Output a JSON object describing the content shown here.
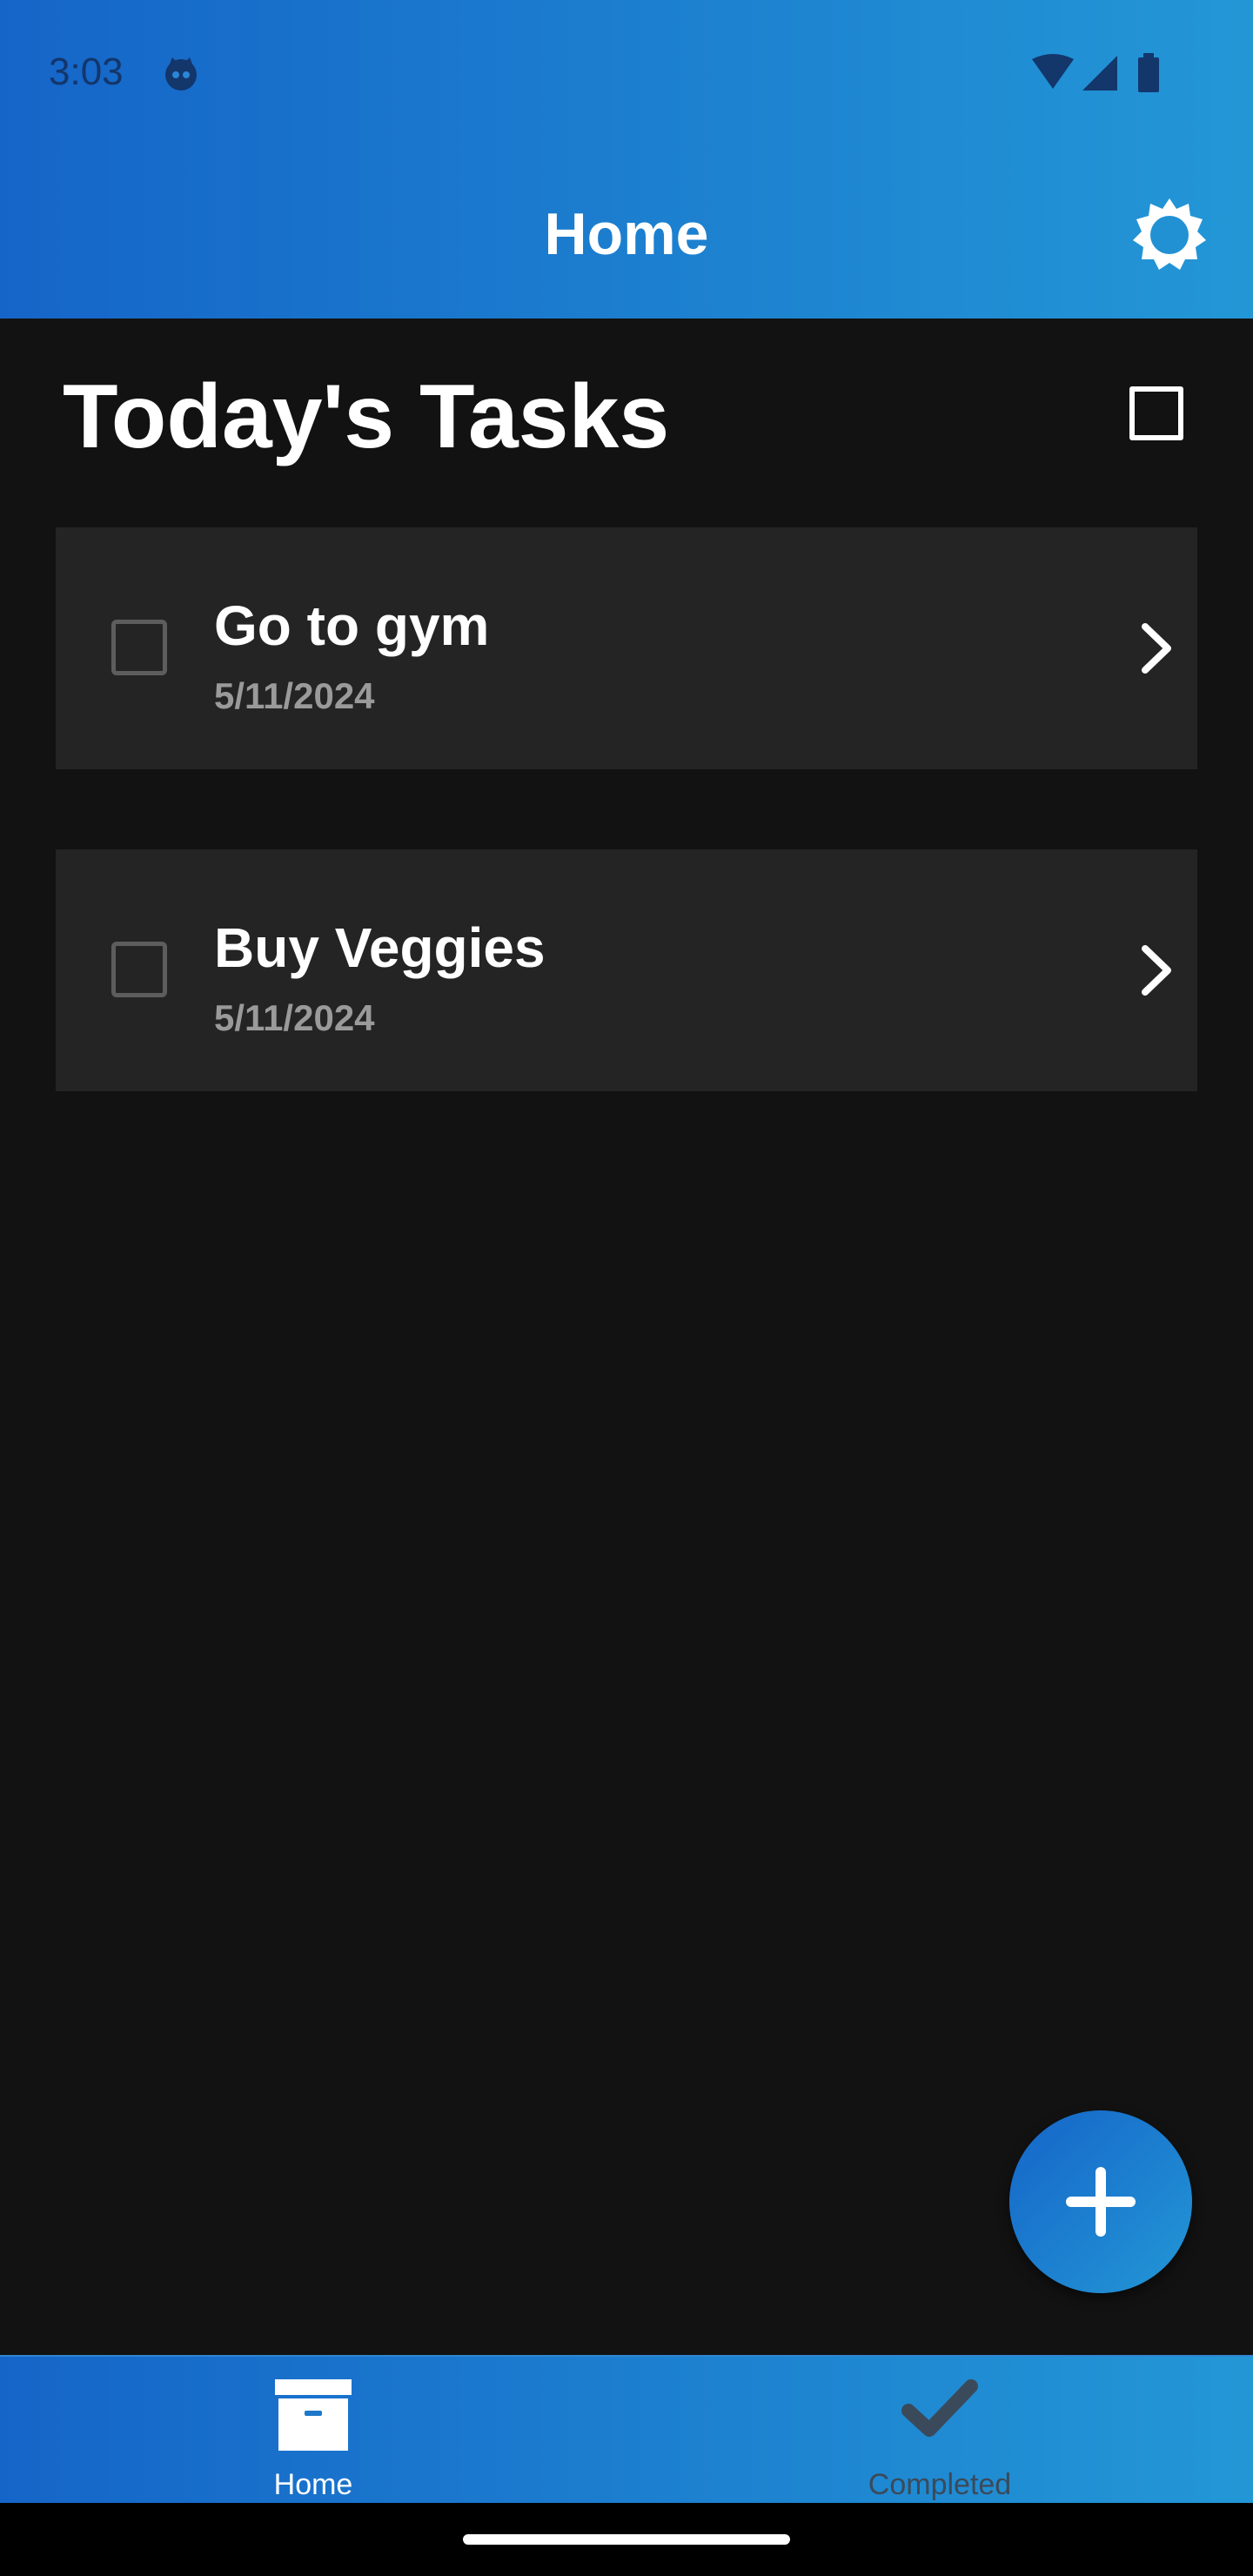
{
  "status_bar": {
    "time": "3:03",
    "icons": [
      "face-icon",
      "wifi-icon",
      "signal-icon",
      "battery-icon"
    ]
  },
  "app_bar": {
    "title": "Home",
    "action_icon": "settings-gear-icon"
  },
  "section": {
    "title": "Today's Tasks",
    "action_icon": "select-square-icon"
  },
  "tasks": [
    {
      "name": "Go to gym",
      "date": "5/11/2024",
      "checked": false
    },
    {
      "name": "Buy Veggies",
      "date": "5/11/2024",
      "checked": false
    }
  ],
  "fab": {
    "icon": "plus-icon"
  },
  "bottom_nav": {
    "items": [
      {
        "label": "Home",
        "icon": "archive-box-icon",
        "active": true
      },
      {
        "label": "Completed",
        "icon": "checkmark-icon",
        "active": false
      }
    ]
  },
  "colors": {
    "primary_start": "#1565c8",
    "primary_end": "#2397d6",
    "background": "#121212",
    "card": "#242424",
    "secondary_text": "#9a9a9a",
    "inactive_nav": "#3b4a5a"
  }
}
